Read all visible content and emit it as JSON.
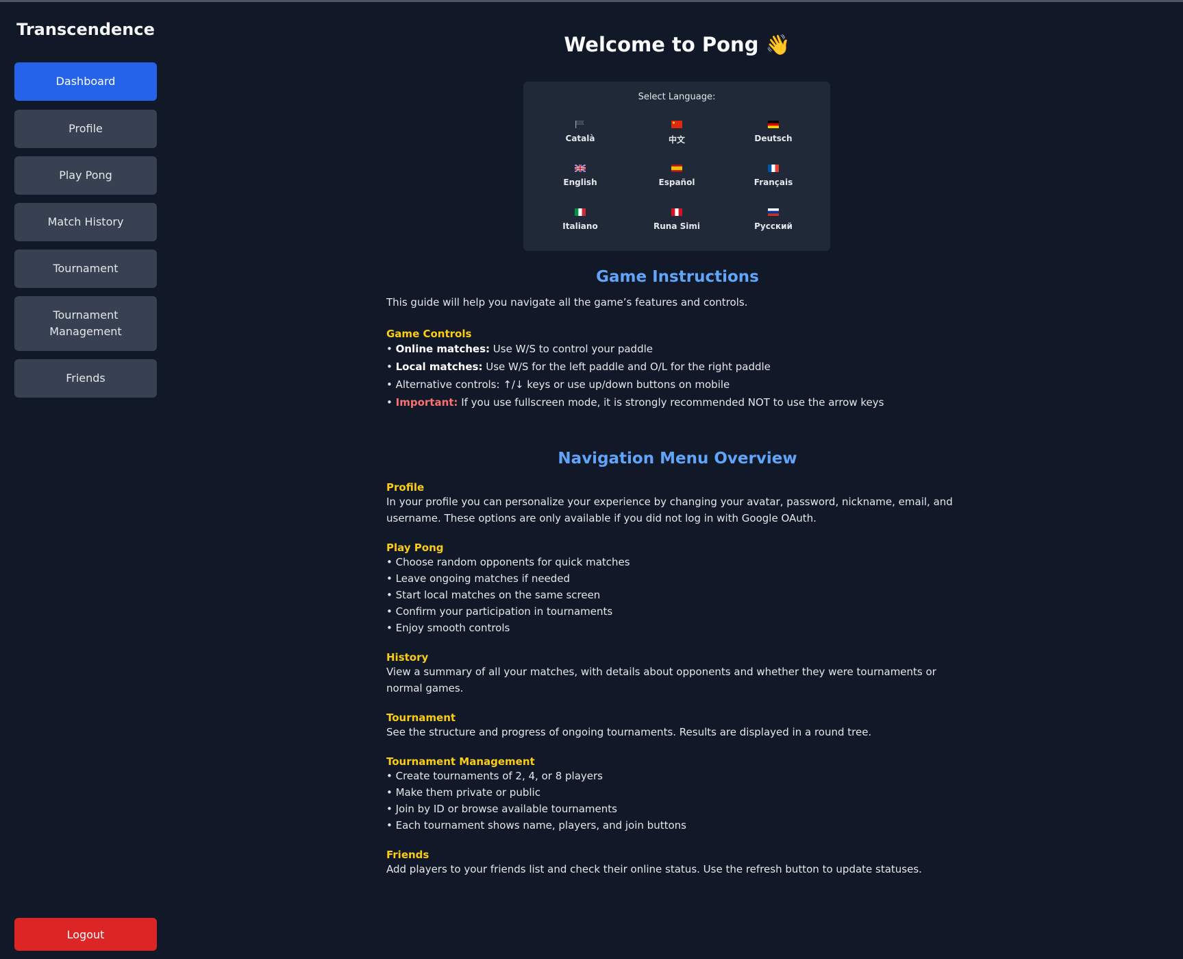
{
  "app": {
    "title": "Transcendence"
  },
  "nav": {
    "items": [
      {
        "label": "Dashboard",
        "active": true
      },
      {
        "label": "Profile"
      },
      {
        "label": "Play Pong"
      },
      {
        "label": "Match History"
      },
      {
        "label": "Tournament"
      },
      {
        "label": "Tournament Management"
      },
      {
        "label": "Friends"
      }
    ],
    "logout_label": "Logout"
  },
  "page": {
    "welcome": "Welcome to Pong 👋"
  },
  "language": {
    "title": "Select Language:",
    "options": [
      {
        "label": "Català",
        "flag_icon": "catalan-flag-icon"
      },
      {
        "label": "中文",
        "flag_icon": "china-flag-icon"
      },
      {
        "label": "Deutsch",
        "flag_icon": "germany-flag-icon"
      },
      {
        "label": "English",
        "flag_icon": "uk-flag-icon"
      },
      {
        "label": "Español",
        "flag_icon": "spain-flag-icon"
      },
      {
        "label": "Français",
        "flag_icon": "france-flag-icon"
      },
      {
        "label": "Italiano",
        "flag_icon": "italy-flag-icon"
      },
      {
        "label": "Runa Simi",
        "flag_icon": "peru-flag-icon"
      },
      {
        "label": "Русский",
        "flag_icon": "russia-flag-icon"
      }
    ]
  },
  "instructions": {
    "title": "Game Instructions",
    "intro": "This guide will help you navigate all the game’s features and controls.",
    "controls_heading": "Game Controls",
    "controls": [
      {
        "prefix": "• ",
        "label": "Online matches:",
        "text": " Use W/S to control your paddle"
      },
      {
        "prefix": "• ",
        "label": "Local matches:",
        "text": " Use W/S for the left paddle and O/L for the right paddle"
      },
      {
        "prefix": "• ",
        "text": "Alternative controls: ↑/↓ keys or use up/down buttons on mobile"
      },
      {
        "prefix": "• ",
        "label": "Important:",
        "text": " If you use fullscreen mode, it is strongly recommended NOT to use the arrow keys"
      }
    ]
  },
  "overview": {
    "title": "Navigation Menu Overview",
    "profile": {
      "heading": "Profile",
      "text": "In your profile you can personalize your experience by changing your avatar, password, nickname, email, and username. These options are only available if you did not log in with Google OAuth."
    },
    "play_pong": {
      "heading": "Play Pong",
      "items": [
        "• Choose random opponents for quick matches",
        "• Leave ongoing matches if needed",
        "• Start local matches on the same screen",
        "• Confirm your participation in tournaments",
        "• Enjoy smooth controls"
      ]
    },
    "history": {
      "heading": "History",
      "text": "View a summary of all your matches, with details about opponents and whether they were tournaments or normal games."
    },
    "tournament": {
      "heading": "Tournament",
      "text": "See the structure and progress of ongoing tournaments. Results are displayed in a round tree."
    },
    "tournament_management": {
      "heading": "Tournament Management",
      "items": [
        "• Create tournaments of 2, 4, or 8 players",
        "• Make them private or public",
        "• Join by ID or browse available tournaments",
        "• Each tournament shows name, players, and join buttons"
      ]
    },
    "friends": {
      "heading": "Friends",
      "text": "Add players to your friends list and check their online status. Use the refresh button to update statuses."
    }
  }
}
